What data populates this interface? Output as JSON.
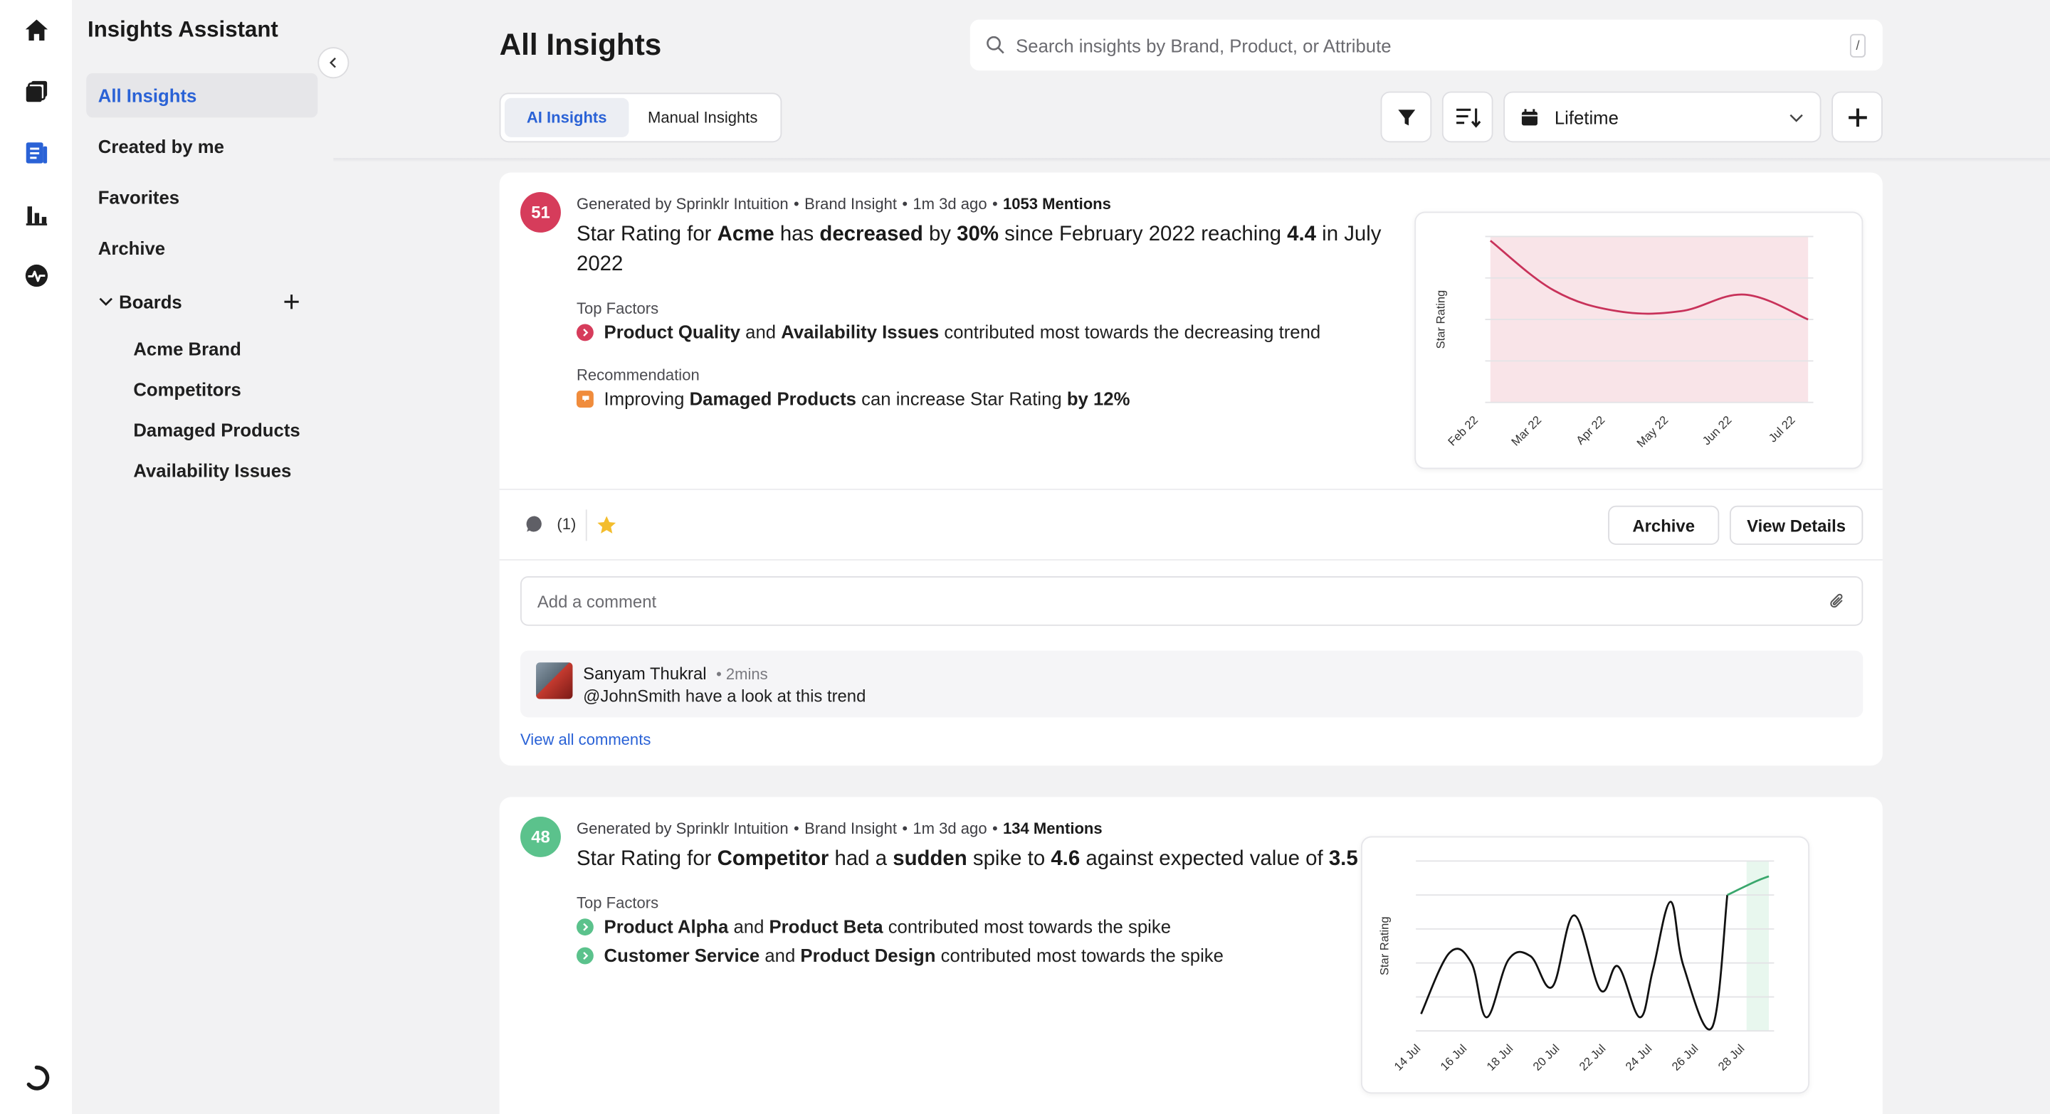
{
  "app": {
    "title": "Insights Assistant"
  },
  "sidebar": {
    "items": [
      {
        "label": "All Insights",
        "active": true
      },
      {
        "label": "Created by me"
      },
      {
        "label": "Favorites"
      },
      {
        "label": "Archive"
      }
    ],
    "boards_label": "Boards",
    "boards": [
      "Acme Brand",
      "Competitors",
      "Damaged Products",
      "Availability Issues"
    ]
  },
  "header": {
    "page_title": "All Insights",
    "search_placeholder": "Search insights by Brand, Product, or Attribute",
    "search_shortcut": "/",
    "tabs": [
      {
        "label": "AI Insights",
        "active": true
      },
      {
        "label": "Manual Insights"
      }
    ],
    "date_range": "Lifetime"
  },
  "colors": {
    "accent": "#2a62d6",
    "score_red": "#d63c5b",
    "score_green": "#5bc28c",
    "trend_red": "#c8325a",
    "highlight_red": "#f9e4e8",
    "highlight_green": "#e8f7ee"
  },
  "insights": [
    {
      "score": "51",
      "source": "Generated by Sprinklr Intuition",
      "type": "Brand Insight",
      "time": "1m 3d ago",
      "mentions": "1053 Mentions",
      "headline": {
        "p1": "Star Rating for ",
        "b1": "Acme",
        "p2": " has ",
        "b2": "decreased",
        "p3": " by ",
        "b3": "30%",
        "p4": " since February 2022 reaching ",
        "b4": "4.4",
        "p5": " in July 2022"
      },
      "top_factors_label": "Top Factors",
      "factors": [
        {
          "b1": "Product Quality",
          "mid": " and ",
          "b2": "Availability Issues",
          "tail": " contributed most towards the decreasing trend"
        }
      ],
      "recommendation_label": "Recommendation",
      "recommendation": {
        "p1": "Improving ",
        "b1": "Damaged Products",
        "p2": " can increase Star Rating ",
        "b2": "by 12%"
      },
      "comment_count": "(1)",
      "archive_label": "Archive",
      "details_label": "View Details",
      "comment_placeholder": "Add a comment",
      "comment": {
        "author": "Sanyam Thukral",
        "time": "2mins",
        "text": "@JohnSmith have a look at this trend"
      },
      "view_all_label": "View all comments"
    },
    {
      "score": "48",
      "source": "Generated by Sprinklr Intuition",
      "type": "Brand Insight",
      "time": "1m 3d ago",
      "mentions": "134 Mentions",
      "headline": {
        "p1": "Star Rating for ",
        "b1": "Competitor",
        "p2": " had a ",
        "b2": "sudden",
        "p3": " spike to ",
        "b3": "4.6",
        "p4": " against expected value of ",
        "b4": "3.5"
      },
      "top_factors_label": "Top Factors",
      "factors": [
        {
          "b1": "Product Alpha",
          "mid": " and ",
          "b2": "Product Beta",
          "tail": " contributed most towards the spike"
        },
        {
          "b1": "Customer Service",
          "mid": " and ",
          "b2": "Product Design",
          "tail": " contributed most towards the spike"
        }
      ]
    }
  ],
  "chart_data": [
    {
      "type": "line",
      "ylabel": "Star Rating",
      "xlabel": "",
      "categories": [
        "Feb 22",
        "Mar 22",
        "Apr 22",
        "May 22",
        "Jun 22",
        "Jul 22"
      ],
      "series": [
        {
          "values": [
            3.9,
            2.7,
            2.2,
            2.2,
            2.6,
            2.0
          ]
        }
      ],
      "ylim": [
        0,
        4
      ],
      "highlight_range": [
        "Feb 22",
        "Jul 22"
      ],
      "grid": true
    },
    {
      "type": "line",
      "ylabel": "Star Rating",
      "xlabel": "",
      "categories": [
        "14 Jul",
        "16 Jul",
        "18 Jul",
        "20 Jul",
        "22 Jul",
        "24 Jul",
        "26 Jul",
        "28 Jul"
      ],
      "x": [
        0,
        1.3,
        2.3,
        3.0,
        4.0,
        5.0,
        6.0,
        7.0,
        8.2,
        9.0,
        10.0,
        10.6,
        11.4,
        12.0,
        13.3,
        14.0,
        15.3,
        15.9
      ],
      "series": [
        {
          "values": [
            0.5,
            2.3,
            2.0,
            0.4,
            2.1,
            2.2,
            1.3,
            3.4,
            1.2,
            1.9,
            0.4,
            1.8,
            3.8,
            1.9,
            0.1,
            4.0,
            4.4,
            4.55
          ]
        }
      ],
      "ylim": [
        0,
        5
      ],
      "highlight_range": [
        15.0,
        15.9
      ],
      "grid": true
    }
  ]
}
